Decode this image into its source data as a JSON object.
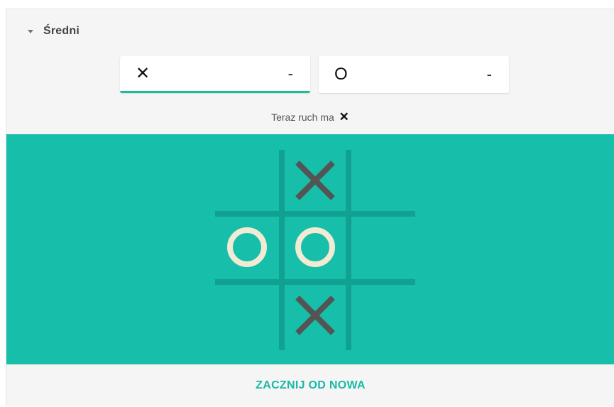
{
  "difficulty": {
    "label": "Średni"
  },
  "scoreboard": {
    "player_x": {
      "symbol": "✕",
      "score": "-"
    },
    "player_o": {
      "symbol": "O",
      "score": "-"
    }
  },
  "turn": {
    "text": "Teraz ruch ma",
    "mark": "✕"
  },
  "board": {
    "cells": [
      "",
      "X",
      "",
      "O",
      "O",
      "",
      "",
      "X",
      ""
    ]
  },
  "colors": {
    "board_bg": "#17bea9",
    "grid_line": "#11a091",
    "x_mark": "#545454",
    "o_mark": "#f2ebd3",
    "accent": "#1abc9c"
  },
  "footer": {
    "restart_label": "ZACZNIJ OD NOWA"
  }
}
